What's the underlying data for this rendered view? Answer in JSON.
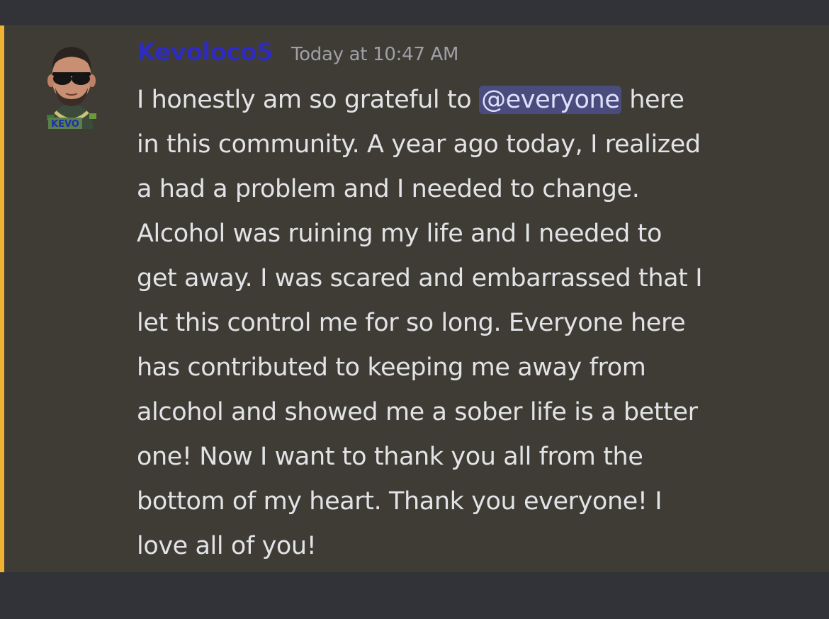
{
  "message": {
    "author": {
      "username": "Kevoloco5",
      "avatar_badge": "KEVO"
    },
    "timestamp": "Today at 10:47 AM",
    "mention": "@everyone",
    "lines": {
      "l1_before": "I honestly am so grateful to ",
      "l1_after": " here",
      "l2": "in this community. A year ago today, I realized",
      "l3": "a had a problem and I needed to change.",
      "l4": "Alcohol was ruining my life and I needed to",
      "l5": "get away. I was scared and embarrassed that I",
      "l6": "let this control me for so long. Everyone here",
      "l7": "has contributed to keeping me away from",
      "l8": "alcohol and showed me a sober life is a better",
      "l9": "one! Now I want to thank you all from the",
      "l10": "bottom of my heart. Thank you everyone! I",
      "l11": "love all of you!"
    }
  },
  "colors": {
    "background": "#313338",
    "message_highlight": "#3f3c36",
    "highlight_bar": "#f0b232",
    "username": "#2e2bbf",
    "mention_bg": "#4a4c7e",
    "mention_text": "#dee0fc"
  },
  "icons": {
    "avatar": "user-avatar"
  }
}
